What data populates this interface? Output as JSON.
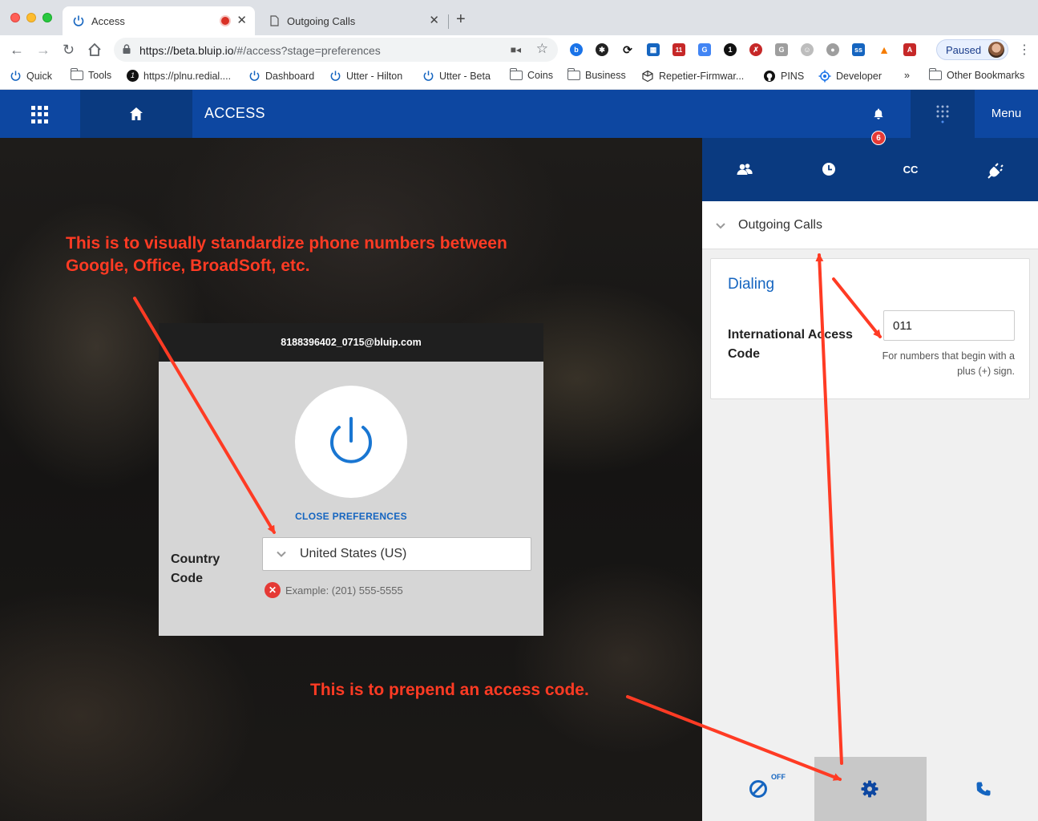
{
  "browser": {
    "tabs": [
      {
        "title": "Access",
        "active": true
      },
      {
        "title": "Outgoing Calls",
        "active": false
      }
    ],
    "url_host": "https://beta.bluip.io",
    "url_path": "/#/access?stage=preferences",
    "paused_label": "Paused",
    "bookmarks": [
      {
        "label": "Quick",
        "icon": "power-icon"
      },
      {
        "label": "Tools",
        "icon": "folder-icon"
      },
      {
        "label": "https://plnu.redial....",
        "icon": "number-1-icon"
      },
      {
        "label": "Dashboard",
        "icon": "power-icon"
      },
      {
        "label": "Utter - Hilton",
        "icon": "power-icon"
      },
      {
        "label": "Utter - Beta",
        "icon": "power-icon"
      },
      {
        "label": "Coins",
        "icon": "folder-icon"
      },
      {
        "label": "Business",
        "icon": "folder-icon"
      },
      {
        "label": "Repetier-Firmwar...",
        "icon": "cube-icon"
      },
      {
        "label": "PINS",
        "icon": "github-icon"
      },
      {
        "label": "Developer",
        "icon": "target-icon"
      },
      {
        "label": "»",
        "icon": "overflow-icon"
      },
      {
        "label": "Other Bookmarks",
        "icon": "folder-icon"
      }
    ],
    "extension_badge": "11"
  },
  "app": {
    "title": "ACCESS",
    "menu_label": "Menu",
    "notification_count": "6"
  },
  "login_card": {
    "account": "8188396402_0715@bluip.com",
    "close_preferences": "CLOSE PREFERENCES",
    "country_code_label": "Country Code",
    "country_value": "United States (US)",
    "example": "Example: (201) 555-5555"
  },
  "panel": {
    "tab_cc_label": "CC",
    "section_title": "Outgoing Calls",
    "dialing_title": "Dialing",
    "iac_label": "International Access Code",
    "iac_value": "011",
    "iac_hint": "For numbers that begin with a plus (+) sign.",
    "dnd_state": "OFF"
  },
  "annotations": {
    "note_1": "This is to visually standardize phone numbers between Google, Office, BroadSoft, etc.",
    "note_2": "This is to prepend an access code."
  },
  "colors": {
    "brand_blue": "#0d47a1",
    "brand_dark": "#0a3a80",
    "accent_blue": "#1565c0",
    "annotation_red": "#ff3b24",
    "error_red": "#e53935"
  }
}
